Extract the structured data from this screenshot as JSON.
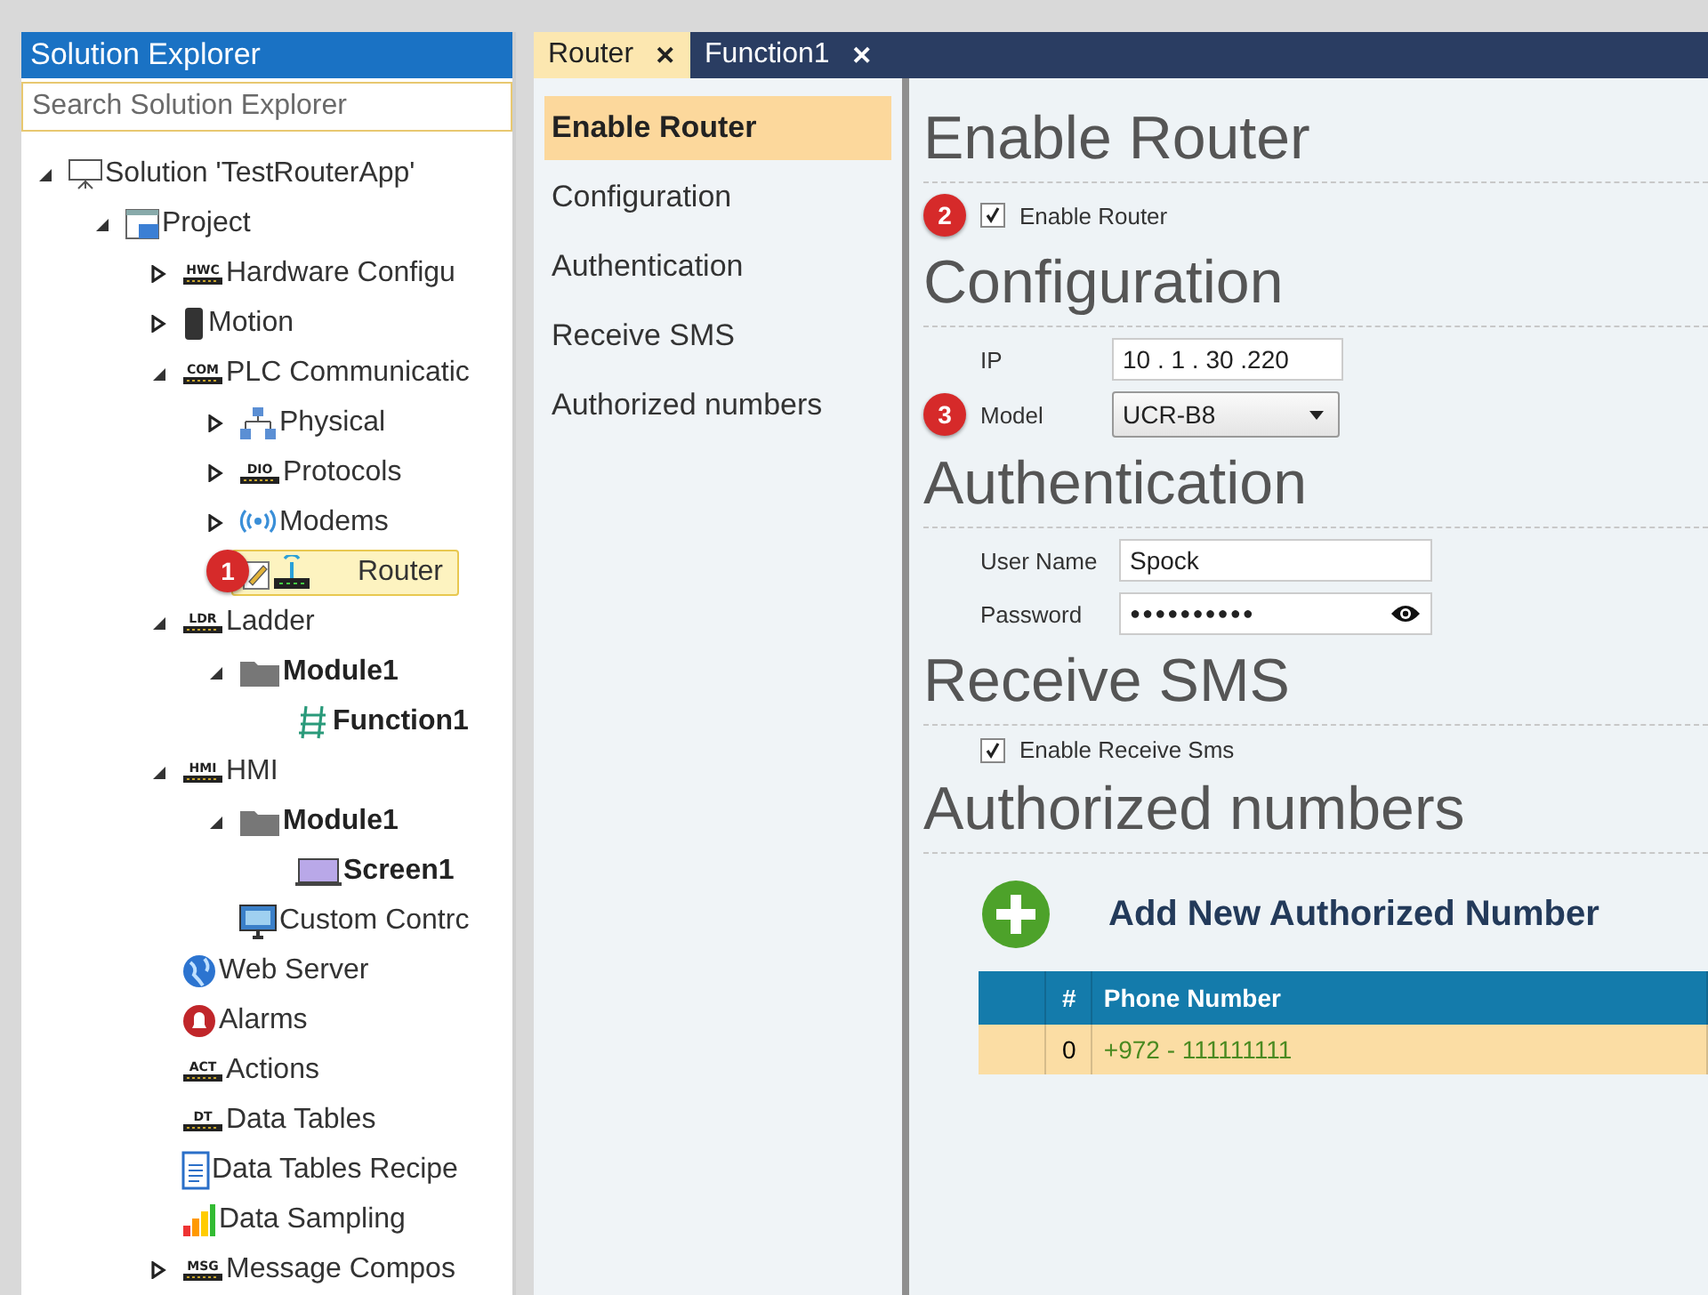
{
  "solution_explorer": {
    "title": "Solution Explorer",
    "search": {
      "placeholder": "Search Solution Explorer"
    },
    "tree": [
      {
        "label": "Solution 'TestRouterApp'",
        "kind": "solution",
        "expanded": true,
        "bold": false,
        "selected": false,
        "children": [
          {
            "label": "Project",
            "kind": "project",
            "expanded": true,
            "bold": false,
            "selected": false,
            "children": [
              {
                "label": "Hardware Configu",
                "kind": "chip",
                "icon_text": "HWC",
                "expanded": false,
                "bold": false,
                "selected": false
              },
              {
                "label": "Motion",
                "kind": "device",
                "expanded": false,
                "bold": false,
                "selected": false
              },
              {
                "label": "PLC Communicatic",
                "kind": "chip",
                "icon_text": "COM",
                "expanded": true,
                "bold": false,
                "selected": false,
                "children": [
                  {
                    "label": "Physical",
                    "kind": "network",
                    "expanded": false,
                    "bold": false,
                    "selected": false
                  },
                  {
                    "label": "Protocols",
                    "kind": "chip",
                    "icon_text": "DIO",
                    "expanded": false,
                    "bold": false,
                    "selected": false
                  },
                  {
                    "label": "Modems",
                    "kind": "wireless",
                    "expanded": false,
                    "bold": false,
                    "selected": false
                  },
                  {
                    "label": "Router",
                    "kind": "router",
                    "badge": "1",
                    "bold": false,
                    "selected": true
                  }
                ]
              },
              {
                "label": "Ladder",
                "kind": "chip",
                "icon_text": "LDR",
                "expanded": true,
                "bold": false,
                "selected": false,
                "children": [
                  {
                    "label": "Module1",
                    "kind": "folder",
                    "expanded": true,
                    "bold": true,
                    "selected": false,
                    "children": [
                      {
                        "label": "Function1",
                        "kind": "ladder",
                        "bold": true,
                        "selected": false
                      }
                    ]
                  }
                ]
              },
              {
                "label": "HMI",
                "kind": "chip",
                "icon_text": "HMI",
                "expanded": true,
                "bold": false,
                "selected": false,
                "children": [
                  {
                    "label": "Module1",
                    "kind": "folder",
                    "expanded": true,
                    "bold": true,
                    "selected": false,
                    "children": [
                      {
                        "label": "Screen1",
                        "kind": "screen",
                        "bold": true,
                        "selected": false
                      }
                    ]
                  },
                  {
                    "label": "Custom Contrc",
                    "kind": "monitor",
                    "bold": false,
                    "selected": false
                  }
                ]
              },
              {
                "label": "Web Server",
                "kind": "globe",
                "bold": false,
                "selected": false
              },
              {
                "label": "Alarms",
                "kind": "alarm",
                "bold": false,
                "selected": false
              },
              {
                "label": "Actions",
                "kind": "chip",
                "icon_text": "ACT",
                "bold": false,
                "selected": false
              },
              {
                "label": "Data Tables",
                "kind": "chip",
                "icon_text": "DT",
                "bold": false,
                "selected": false
              },
              {
                "label": "Data Tables Recipe",
                "kind": "document",
                "bold": false,
                "selected": false
              },
              {
                "label": "Data Sampling",
                "kind": "chart",
                "bold": false,
                "selected": false
              },
              {
                "label": "Message Compos",
                "kind": "chip",
                "icon_text": "MSG",
                "expanded": false,
                "bold": false,
                "selected": false
              }
            ]
          }
        ]
      }
    ]
  },
  "tabs": [
    {
      "label": "Router",
      "close": "✕",
      "selected": true
    },
    {
      "label": "Function1",
      "close": "✕",
      "selected": false
    }
  ],
  "nav": [
    {
      "label": "Enable Router",
      "selected": true
    },
    {
      "label": "Configuration",
      "selected": false
    },
    {
      "label": "Authentication",
      "selected": false
    },
    {
      "label": "Receive SMS",
      "selected": false
    },
    {
      "label": "Authorized numbers",
      "selected": false
    }
  ],
  "sections": [
    {
      "heading": "Enable Router",
      "fields": [
        {
          "kind": "checkbox",
          "badge": "2",
          "label": "Enable Router",
          "checked": true
        }
      ]
    },
    {
      "heading": "Configuration",
      "fields": [
        {
          "kind": "text",
          "label": "IP",
          "value": "10 . 1 . 30 .220"
        },
        {
          "kind": "select",
          "badge": "3",
          "label": "Model",
          "value": "UCR-B8"
        }
      ]
    },
    {
      "heading": "Authentication",
      "fields": [
        {
          "kind": "text",
          "label": "User Name",
          "value": "Spock"
        },
        {
          "kind": "password",
          "label": "Password",
          "value": "●●●●●●●●●●"
        }
      ]
    },
    {
      "heading": "Receive SMS",
      "fields": [
        {
          "kind": "checkbox",
          "label": "Enable Receive Sms",
          "checked": true
        }
      ]
    },
    {
      "heading": "Authorized numbers",
      "fields": [
        {
          "kind": "add",
          "label": "Add New Authorized Number"
        },
        {
          "kind": "table",
          "columns": [
            "#",
            "Phone Number"
          ],
          "rows": [
            {
              "cells": [
                "0",
                "+972 - 111111111"
              ],
              "selected": true
            }
          ]
        }
      ]
    }
  ]
}
